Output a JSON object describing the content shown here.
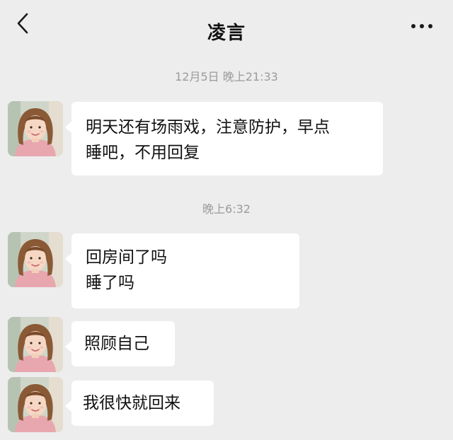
{
  "header": {
    "title": "凌言",
    "back_icon": "chevron-left-icon",
    "more_icon": "more-horizontal-icon"
  },
  "chat": {
    "messages": [
      {
        "time": "12月5日 晚上21:33",
        "lines": [
          "明天还有场雨戏，注意防护，早点",
          "睡吧，不用回复"
        ]
      },
      {
        "time": "晚上6:32",
        "lines": [
          "回房间了吗",
          "睡了吗"
        ]
      },
      {
        "lines": [
          "照顾自己"
        ]
      },
      {
        "lines": [
          "我很快就回来"
        ]
      }
    ]
  },
  "colors": {
    "background": "#ededed",
    "bubble": "#ffffff",
    "timestamp": "#9b9b9b",
    "text": "#111111"
  }
}
